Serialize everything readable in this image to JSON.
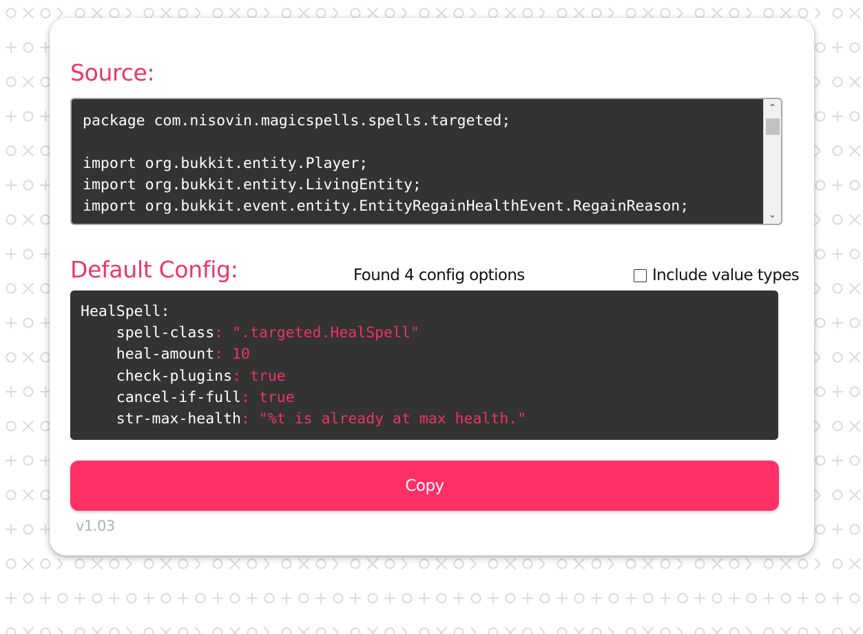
{
  "source": {
    "title": "Source:",
    "code": "package com.nisovin.magicspells.spells.targeted;\n\nimport org.bukkit.entity.Player;\nimport org.bukkit.entity.LivingEntity;\nimport org.bukkit.event.entity.EntityRegainHealthEvent.RegainReason;\n"
  },
  "config": {
    "title": "Default Config:",
    "found_label": "Found 4 config options",
    "include_types_label": "Include value types",
    "include_types_checked": false,
    "root": "HealSpell:",
    "entries": [
      {
        "key": "spell-class",
        "value": "\".targeted.HealSpell\""
      },
      {
        "key": "heal-amount",
        "value": "10"
      },
      {
        "key": "check-plugins",
        "value": "true"
      },
      {
        "key": "cancel-if-full",
        "value": "true"
      },
      {
        "key": "str-max-health",
        "value": "\"%t is already at max health.\""
      }
    ]
  },
  "copy_button_label": "Copy",
  "version": "v1.03",
  "icons": {
    "scroll_up": "chevron-up-icon",
    "scroll_down": "chevron-down-icon",
    "checkbox": "checkbox-icon"
  },
  "colors": {
    "accent": "#ee3466",
    "button": "#ff3065",
    "code_background": "#333333",
    "pattern": "#dcdcdc"
  }
}
